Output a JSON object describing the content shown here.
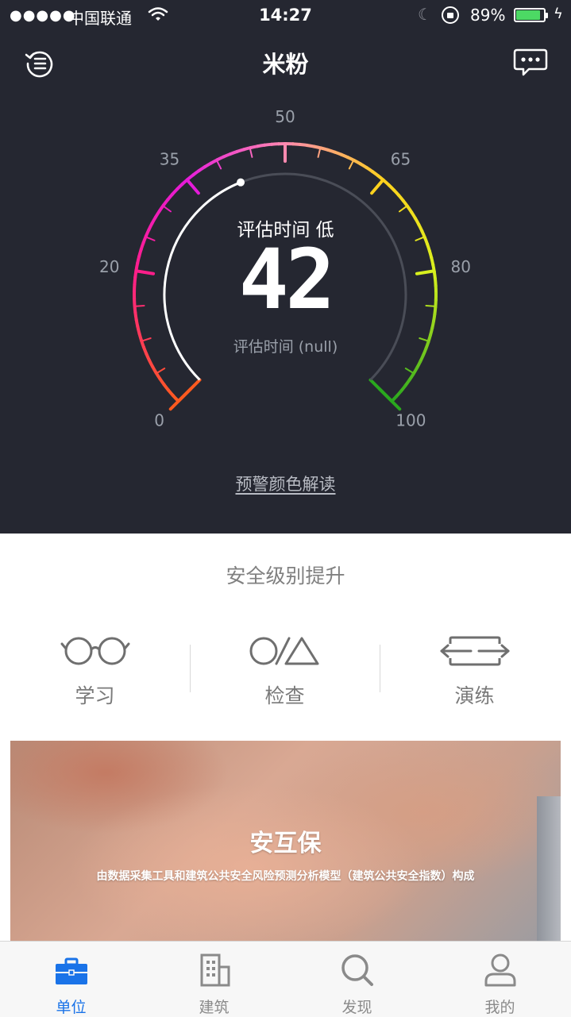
{
  "status_bar": {
    "signal": "●●●●●",
    "carrier": "中国联通",
    "time": "14:27",
    "battery_percent": "89%",
    "battery_level": 0.89,
    "icons": [
      "wifi-icon",
      "moon-icon",
      "rotation-lock-icon",
      "battery-icon",
      "charging-icon"
    ]
  },
  "nav": {
    "title": "米粉",
    "left_icon": "history-icon",
    "right_icon": "chat-icon"
  },
  "gauge": {
    "value": "42",
    "caption": "评估时间 低",
    "subcaption": "评估时间 (null)",
    "scale_labels": [
      "0",
      "20",
      "35",
      "50",
      "65",
      "80",
      "100"
    ],
    "scale_colors": [
      "#ff5a1f",
      "#ff1e8a",
      "#e51bd9",
      "#ff8ab0",
      "#ffd21e",
      "#d8f01e",
      "#2aa81e"
    ],
    "legend_link": "预警颜色解读"
  },
  "section": {
    "title": "安全级别提升",
    "actions": [
      {
        "label": "学习",
        "icon": "glasses-icon"
      },
      {
        "label": "检查",
        "icon": "shapes-icon"
      },
      {
        "label": "演练",
        "icon": "exchange-icon"
      }
    ]
  },
  "banner": {
    "title": "安互保",
    "subtitle": "由数据采集工具和建筑公共安全风险预测分析模型（建筑公共安全指数）构成"
  },
  "tabbar": {
    "active_color": "#1a73e8",
    "tabs": [
      {
        "label": "单位",
        "icon": "briefcase-icon",
        "active": true
      },
      {
        "label": "建筑",
        "icon": "building-icon",
        "active": false
      },
      {
        "label": "发现",
        "icon": "search-icon",
        "active": false
      },
      {
        "label": "我的",
        "icon": "person-icon",
        "active": false
      }
    ]
  }
}
